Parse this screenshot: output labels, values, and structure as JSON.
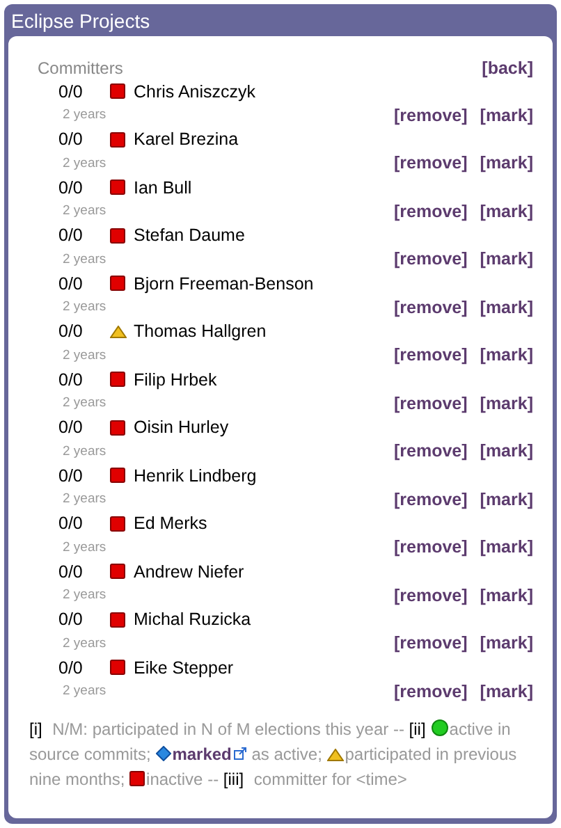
{
  "window": {
    "title": "Eclipse Projects"
  },
  "heading": "Committers",
  "back_link": "[back]",
  "committers": [
    {
      "count": "0/0",
      "kind": "inactive",
      "name": "Chris Aniszczyk",
      "tenure": "2 years",
      "remove": "[remove]",
      "mark": "[mark]"
    },
    {
      "count": "0/0",
      "kind": "inactive",
      "name": "Karel Brezina",
      "tenure": "2 years",
      "remove": "[remove]",
      "mark": "[mark]"
    },
    {
      "count": "0/0",
      "kind": "inactive",
      "name": "Ian Bull",
      "tenure": "2 years",
      "remove": "[remove]",
      "mark": "[mark]"
    },
    {
      "count": "0/0",
      "kind": "inactive",
      "name": "Stefan Daume",
      "tenure": "2 years",
      "remove": "[remove]",
      "mark": "[mark]"
    },
    {
      "count": "0/0",
      "kind": "inactive",
      "name": "Bjorn Freeman-Benson",
      "tenure": "2 years",
      "remove": "[remove]",
      "mark": "[mark]"
    },
    {
      "count": "0/0",
      "kind": "participated",
      "name": "Thomas Hallgren",
      "tenure": "2 years",
      "remove": "[remove]",
      "mark": "[mark]"
    },
    {
      "count": "0/0",
      "kind": "inactive",
      "name": "Filip Hrbek",
      "tenure": "2 years",
      "remove": "[remove]",
      "mark": "[mark]"
    },
    {
      "count": "0/0",
      "kind": "inactive",
      "name": "Oisin Hurley",
      "tenure": "2 years",
      "remove": "[remove]",
      "mark": "[mark]"
    },
    {
      "count": "0/0",
      "kind": "inactive",
      "name": "Henrik Lindberg",
      "tenure": "2 years",
      "remove": "[remove]",
      "mark": "[mark]"
    },
    {
      "count": "0/0",
      "kind": "inactive",
      "name": "Ed Merks",
      "tenure": "2 years",
      "remove": "[remove]",
      "mark": "[mark]"
    },
    {
      "count": "0/0",
      "kind": "inactive",
      "name": "Andrew Niefer",
      "tenure": "2 years",
      "remove": "[remove]",
      "mark": "[mark]"
    },
    {
      "count": "0/0",
      "kind": "inactive",
      "name": "Michal Ruzicka",
      "tenure": "2 years",
      "remove": "[remove]",
      "mark": "[mark]"
    },
    {
      "count": "0/0",
      "kind": "inactive",
      "name": "Eike Stepper",
      "tenure": "2 years",
      "remove": "[remove]",
      "mark": "[mark]"
    }
  ],
  "legend": [
    {
      "kind": "marker",
      "text": "[i]"
    },
    {
      "kind": "text",
      "text": " N/M: participated in N of M elections this year -- "
    },
    {
      "kind": "marker",
      "text": "[ii]"
    },
    {
      "kind": "active"
    },
    {
      "kind": "text",
      "text": "active in source commits; "
    },
    {
      "kind": "marked"
    },
    {
      "kind": "link",
      "text": "marked"
    },
    {
      "kind": "text",
      "text": " as active; "
    },
    {
      "kind": "participated"
    },
    {
      "kind": "text",
      "text": "participated in previous nine months; "
    },
    {
      "kind": "inactive"
    },
    {
      "kind": "text",
      "text": "inactive -- "
    },
    {
      "kind": "marker",
      "text": "[iii]"
    },
    {
      "kind": "text",
      "text": " committer for <time>"
    }
  ]
}
